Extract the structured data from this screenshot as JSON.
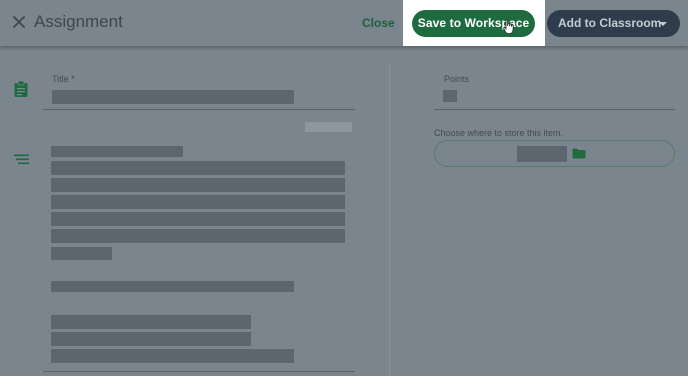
{
  "header": {
    "title": "Assignment",
    "close_label": "Close",
    "save_label": "Save to Workspace",
    "add_label": "Add to Classroom",
    "close_icon": "close-icon",
    "caret_icon": "caret-down-icon"
  },
  "form": {
    "title_label": "Title *",
    "title_icon": "clipboard-icon",
    "description_icon": "description-lines-icon",
    "points_label": "Points",
    "store_label": "Choose where to store this item.",
    "folder_icon": "folder-icon"
  },
  "colors": {
    "overlay": "#7b858d",
    "primary_green": "#1e6b40",
    "dark_navy": "#2e3c4c",
    "placeholder_bar": "#5c666e"
  }
}
